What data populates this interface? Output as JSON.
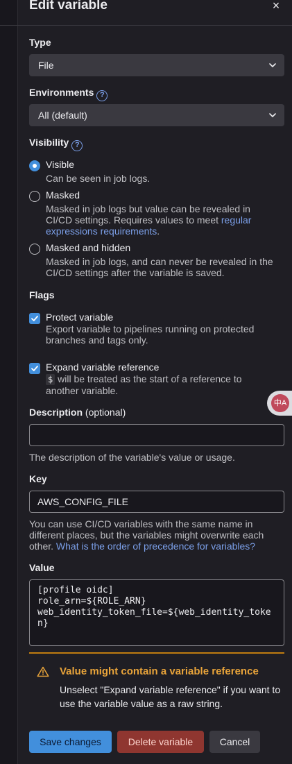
{
  "drawer": {
    "title": "Edit variable",
    "close_label": "×"
  },
  "type": {
    "label": "Type",
    "value": "File"
  },
  "environments": {
    "label": "Environments",
    "value": "All (default)"
  },
  "visibility": {
    "label": "Visibility",
    "options": [
      {
        "title": "Visible",
        "desc": "Can be seen in job logs.",
        "checked": true
      },
      {
        "title": "Masked",
        "desc": "Masked in job logs but value can be revealed in CI/CD settings. Requires values to meet ",
        "link": "regular expressions requirements",
        "desc_end": ".",
        "checked": false
      },
      {
        "title": "Masked and hidden",
        "desc": "Masked in job logs, and can never be revealed in the CI/CD settings after the variable is saved.",
        "checked": false
      }
    ]
  },
  "flags": {
    "label": "Flags",
    "protect": {
      "title": "Protect variable",
      "desc": "Export variable to pipelines running on protected branches and tags only.",
      "checked": true
    },
    "expand": {
      "title": "Expand variable reference",
      "code": "$",
      "desc": "will be treated as the start of a reference to another variable.",
      "checked": true
    }
  },
  "description": {
    "label": "Description",
    "optional": "(optional)",
    "value": "",
    "help": "The description of the variable's value or usage."
  },
  "key": {
    "label": "Key",
    "value": "AWS_CONFIG_FILE",
    "help": "You can use CI/CD variables with the same name in different places, but the variables might overwrite each other.",
    "help_link": "What is the order of precedence for variables?"
  },
  "value": {
    "label": "Value",
    "text": "[profile oidc]\nrole_arn=${ROLE_ARN}\nweb_identity_token_file=${web_identity_token}"
  },
  "alert": {
    "title": "Value might contain a variable reference",
    "body": "Unselect \"Expand variable reference\" if you want to use the variable value as a raw string."
  },
  "buttons": {
    "save": "Save changes",
    "delete": "Delete variable",
    "cancel": "Cancel"
  },
  "translate_fab": {
    "glyph": "中A"
  },
  "colors": {
    "accent": "#428fdc",
    "danger": "#8f3630",
    "warning": "#e9a43a",
    "link": "#7b9fe8"
  }
}
